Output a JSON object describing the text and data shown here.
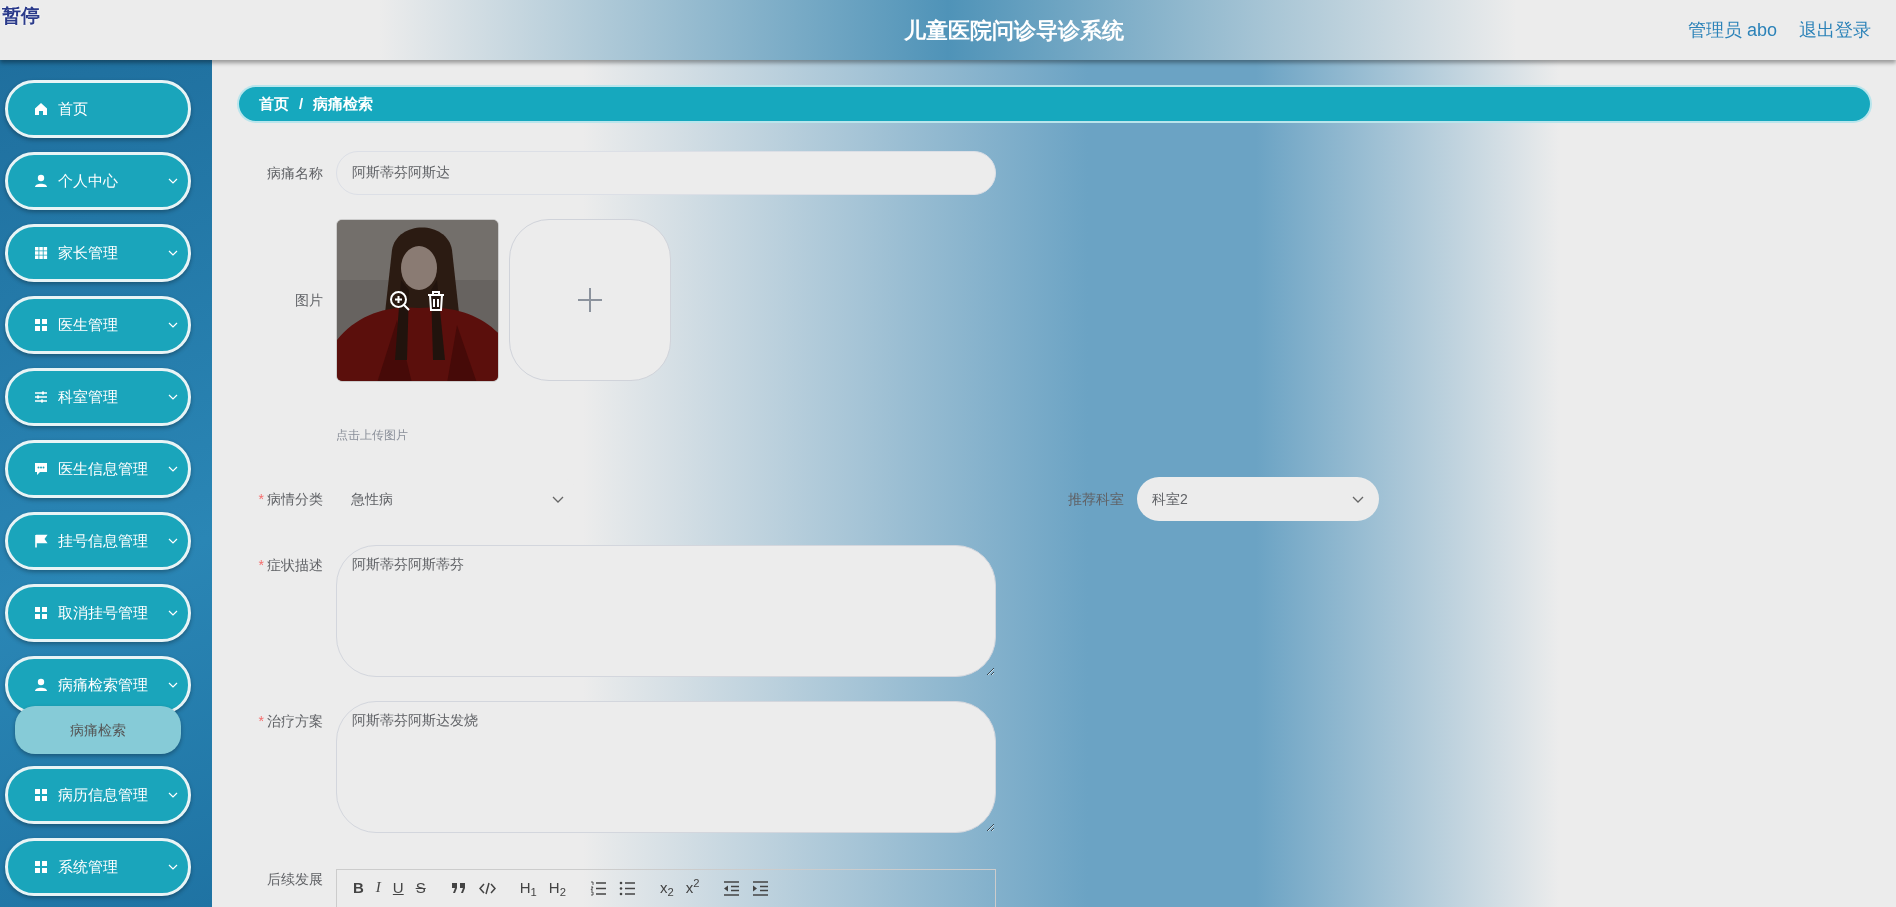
{
  "pause_label": "暂停",
  "header": {
    "title": "儿童医院问诊导诊系统",
    "user": "管理员 abo",
    "logout": "退出登录"
  },
  "sidebar": {
    "items": [
      {
        "label": "首页",
        "kind": "home",
        "has_caret": false
      },
      {
        "label": "个人中心",
        "kind": "user",
        "has_caret": true
      },
      {
        "label": "家长管理",
        "kind": "grid9",
        "has_caret": true
      },
      {
        "label": "医生管理",
        "kind": "grid4",
        "has_caret": true
      },
      {
        "label": "科室管理",
        "kind": "sliders",
        "has_caret": true
      },
      {
        "label": "医生信息管理",
        "kind": "chat",
        "has_caret": true
      },
      {
        "label": "挂号信息管理",
        "kind": "flag",
        "has_caret": true
      },
      {
        "label": "取消挂号管理",
        "kind": "grid4",
        "has_caret": true
      },
      {
        "label": "病痛检索管理",
        "kind": "user",
        "has_caret": true,
        "children": [
          {
            "label": "病痛检索",
            "selected": true
          }
        ]
      },
      {
        "label": "病历信息管理",
        "kind": "grid4",
        "has_caret": true
      },
      {
        "label": "系统管理",
        "kind": "grid4",
        "has_caret": true
      }
    ]
  },
  "breadcrumb": [
    "首页",
    "病痛检索"
  ],
  "breadcrumb_separator": "/",
  "form": {
    "name": {
      "label": "病痛名称",
      "value": "阿斯蒂芬阿斯达"
    },
    "images": {
      "label": "图片",
      "hint": "点击上传图片"
    },
    "category": {
      "label": "病情分类",
      "required_mark": "*",
      "value": "急性病"
    },
    "department": {
      "label": "推荐科室",
      "value": "科室2"
    },
    "symptoms": {
      "label": "症状描述",
      "required_mark": "*",
      "value": "阿斯蒂芬阿斯蒂芬"
    },
    "treatment": {
      "label": "治疗方案",
      "required_mark": "*",
      "value": "阿斯蒂芬阿斯达发烧"
    },
    "followup": {
      "label": "后续发展",
      "toolbar": [
        {
          "kind": "bold",
          "label": "B"
        },
        {
          "kind": "italic",
          "label": "I"
        },
        {
          "kind": "underline",
          "label": "U"
        },
        {
          "kind": "strike",
          "label": "S"
        },
        {
          "kind": "quote"
        },
        {
          "kind": "code"
        },
        {
          "kind": "heading",
          "label": "H$_{1}$"
        },
        {
          "kind": "heading",
          "label": "H$_{2}$"
        },
        {
          "kind": "ordered-list"
        },
        {
          "kind": "bullet-list"
        },
        {
          "kind": "subscript",
          "label": "x$_{2}$"
        },
        {
          "kind": "superscript",
          "label": "x$^{2}$"
        },
        {
          "kind": "outdent"
        },
        {
          "kind": "indent"
        }
      ]
    }
  }
}
